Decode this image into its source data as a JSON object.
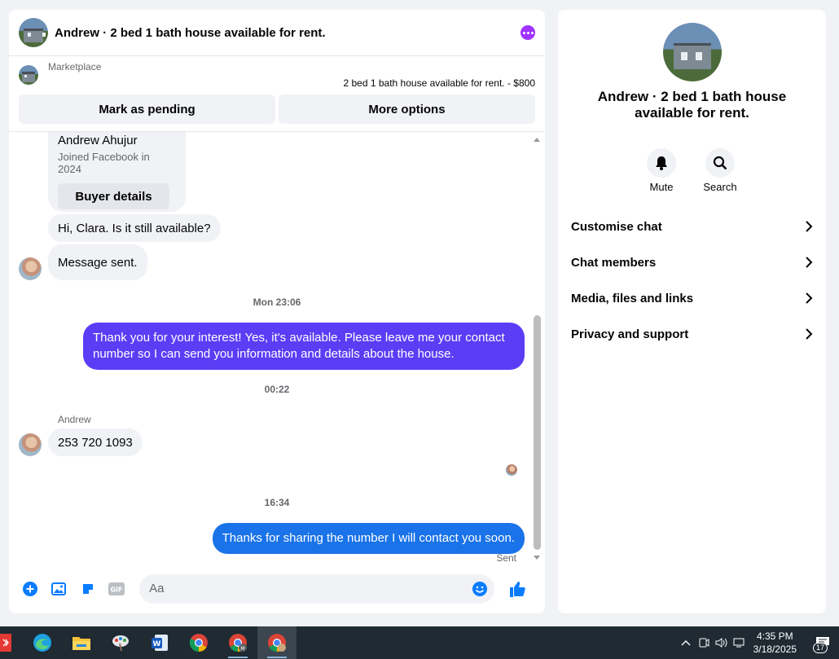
{
  "header": {
    "title": "Andrew · 2 bed 1 bath house available for rent.",
    "more_icon": "more-dots-icon"
  },
  "listing": {
    "source": "Marketplace",
    "price_line": "2 bed 1 bath house available for rent. - $800",
    "mark_pending_label": "Mark as pending",
    "more_options_label": "More options"
  },
  "messages": [
    {
      "type": "profile_card",
      "name": "Andrew Ahujur",
      "joined": "Joined Facebook in 2024",
      "button": "Buyer details"
    },
    {
      "type": "incoming",
      "text": "Hi, Clara. Is it still available?"
    },
    {
      "type": "incoming",
      "text": "Message sent."
    },
    {
      "type": "timestamp",
      "text": "Mon 23:06"
    },
    {
      "type": "outgoing",
      "text": "Thank you for your interest! Yes, it's available. Please leave me your contact number so I can send you information and details about the house.",
      "color": "#5b3df5"
    },
    {
      "type": "timestamp",
      "text": "00:22"
    },
    {
      "type": "sender",
      "text": "Andrew"
    },
    {
      "type": "incoming",
      "text": "253 720 1093"
    },
    {
      "type": "timestamp",
      "text": "16:34"
    },
    {
      "type": "outgoing",
      "text": "Thanks for sharing the number I will contact you soon.",
      "color": "#1a73e8"
    },
    {
      "type": "status",
      "text": "Sent"
    }
  ],
  "composer": {
    "placeholder": "Aa",
    "icons": [
      "plus-circle-icon",
      "image-icon",
      "sticker-icon",
      "gif-icon",
      "emoji-icon",
      "thumbs-up-icon"
    ],
    "accent": "#0a7cff"
  },
  "info_panel": {
    "title": "Andrew · 2 bed 1 bath house available for rent.",
    "actions": [
      {
        "label": "Mute",
        "icon": "bell-icon"
      },
      {
        "label": "Search",
        "icon": "search-icon"
      }
    ],
    "menu": [
      {
        "label": "Customise chat"
      },
      {
        "label": "Chat members"
      },
      {
        "label": "Media, files and links"
      },
      {
        "label": "Privacy and support"
      }
    ]
  },
  "taskbar": {
    "apps": [
      "edge-icon",
      "file-explorer-icon",
      "paint-icon",
      "word-icon",
      "chrome-icon",
      "chrome-profile-icon",
      "chrome-profile-icon-2"
    ],
    "time": "4:35 PM",
    "date": "3/18/2025",
    "notification_count": "17"
  }
}
